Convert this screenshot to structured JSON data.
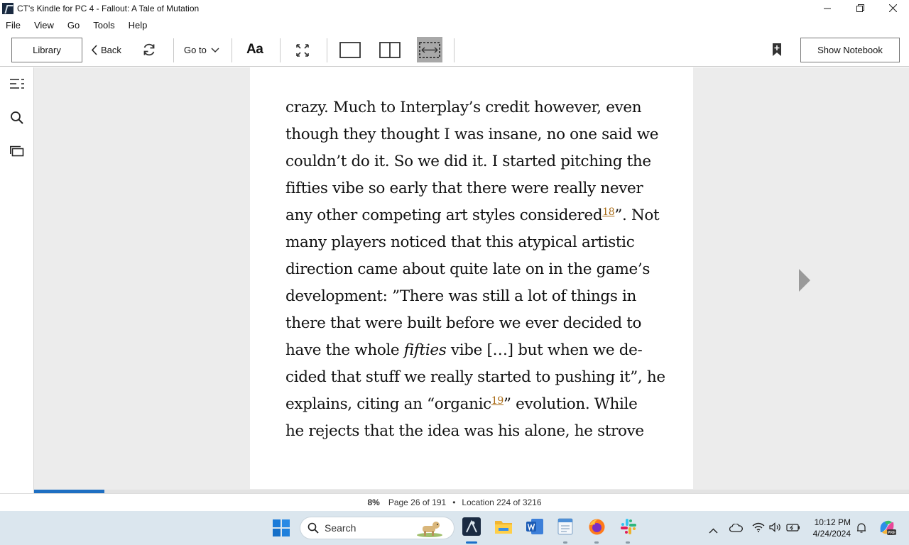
{
  "window": {
    "title": "CT's Kindle for PC 4 - Fallout: A Tale of Mutation"
  },
  "menu": [
    "File",
    "View",
    "Go",
    "Tools",
    "Help"
  ],
  "toolbar": {
    "library_label": "Library",
    "back_label": "Back",
    "goto_label": "Go to",
    "font_label": "Aa",
    "notebook_label": "Show Notebook"
  },
  "page": {
    "lines": [
      "crazy. Much to Interplay’s credit however, even",
      "though they thought I was insane, no one said we",
      "couldn’t do it. So we did it. I started pitching the",
      "fifties vibe so early that there were really never",
      {
        "before": "any other competing art styles considered",
        "footnote": "18",
        "after": "”. Not"
      },
      "many players noticed that this atypical artistic",
      "direction came about quite late on in the game’s",
      "development: ”There was still a lot of things in",
      "there that were built before we ever decided to",
      {
        "before": "have the whole ",
        "italic": "fifties",
        "after": " vibe […] but when we de-"
      },
      "cided that stuff we really started to pushing it”, he",
      {
        "before": "explains, citing an “organic",
        "footnote": "19",
        "after": "” evolution. While"
      },
      "he rejects that the idea was his alone, he strove"
    ]
  },
  "progress": {
    "fraction": 0.08
  },
  "status": {
    "percent": "8%",
    "page": "Page 26 of 191",
    "separator": "•",
    "location": "Location 224 of 3216"
  },
  "taskbar": {
    "search_label": "Search",
    "time": "10:12 PM",
    "date": "4/24/2024"
  },
  "colors": {
    "footnote": "#a86a14",
    "progress": "#1e6fc2",
    "taskbar": "#dbe6ee"
  }
}
